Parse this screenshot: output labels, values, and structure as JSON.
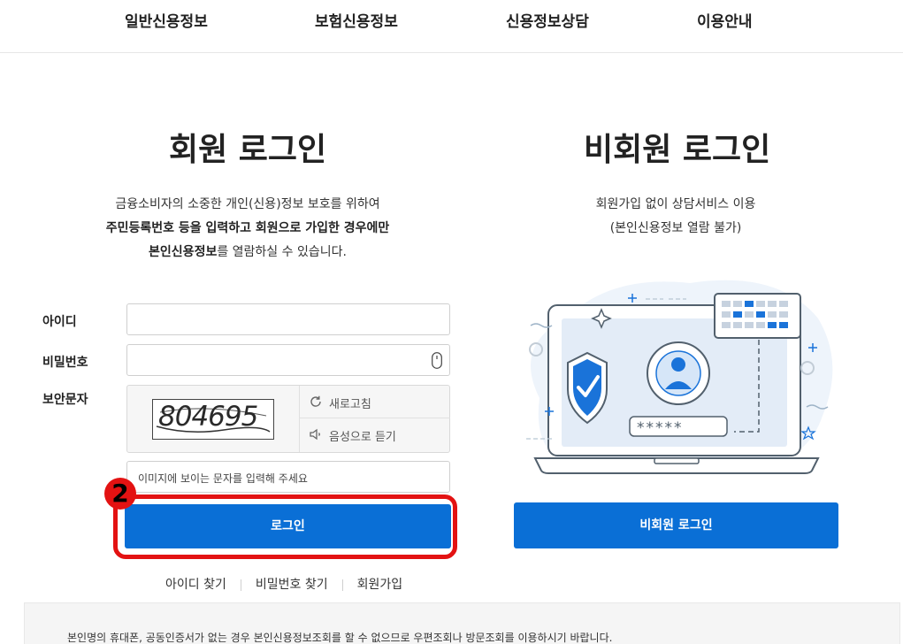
{
  "nav": {
    "items": [
      "일반신용정보",
      "보험신용정보",
      "신용정보상담",
      "이용안내"
    ]
  },
  "member": {
    "title": "회원 로그인",
    "desc_line1": "금융소비자의 소중한 개인(신용)정보 보호를 위하여",
    "desc_line2": "주민등록번호 등을 입력하고 회원으로 가입한 경우에만",
    "desc_line3_bold": "본인신용정보",
    "desc_line3_rest": "를 열람하실 수 있습니다.",
    "id_label": "아이디",
    "pw_label": "비밀번호",
    "captcha_label": "보안문자",
    "captcha_value": "804695",
    "refresh_label": "새로고침",
    "audio_label": "음성으로 듣기",
    "captcha_placeholder": "이미지에 보이는 문자를 입력해 주세요",
    "login_button": "로그인",
    "links": [
      "아이디 찾기",
      "비밀번호 찾기",
      "회원가입"
    ]
  },
  "guest": {
    "title": "비회원 로그인",
    "desc_line1": "회원가입 없이 상담서비스 이용",
    "desc_line2": "(본인신용정보 열람 불가)",
    "login_button": "비회원 로그인",
    "password_mask": "*****"
  },
  "annotation": {
    "step": "2"
  },
  "notice": {
    "text": "본인명의 휴대폰, 공동인증서가 없는 경우 본인신용정보조회를 할 수 없으므로 우편조회나 방문조회를 이용하시기 바랍니다."
  },
  "colors": {
    "primary": "#0a6fd6",
    "highlight": "#e31212"
  }
}
